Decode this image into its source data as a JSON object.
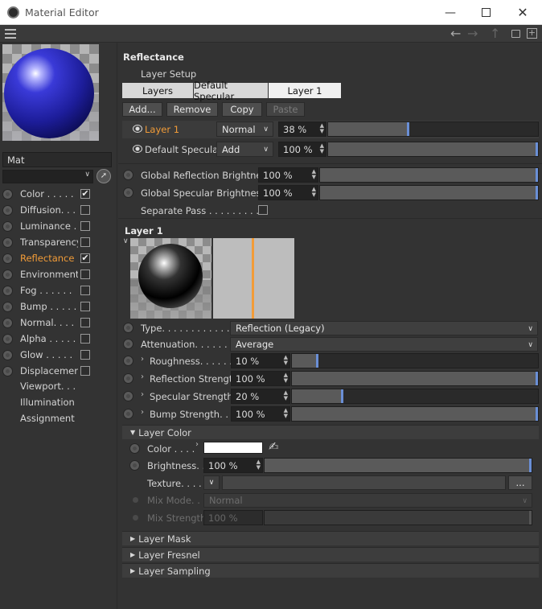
{
  "window": {
    "title": "Material Editor"
  },
  "material": {
    "name": "Mat"
  },
  "channels": [
    {
      "label": "Color . . . . .",
      "checked": true,
      "active": false
    },
    {
      "label": "Diffusion. . .",
      "checked": false,
      "active": false
    },
    {
      "label": "Luminance . .",
      "checked": false,
      "active": false
    },
    {
      "label": "Transparency",
      "checked": false,
      "active": false
    },
    {
      "label": "Reflectance .",
      "checked": true,
      "active": true
    },
    {
      "label": "Environment",
      "checked": false,
      "active": false
    },
    {
      "label": "Fog . . . . . .",
      "checked": false,
      "active": false
    },
    {
      "label": "Bump . . . . .",
      "checked": false,
      "active": false
    },
    {
      "label": "Normal. . . .",
      "checked": false,
      "active": false
    },
    {
      "label": "Alpha . . . . .",
      "checked": false,
      "active": false
    },
    {
      "label": "Glow . . . . .",
      "checked": false,
      "active": false
    },
    {
      "label": "Displacement",
      "checked": false,
      "active": false
    }
  ],
  "extras": [
    "Viewport. . .",
    "Illumination",
    "Assignment"
  ],
  "reflectance": {
    "title": "Reflectance",
    "layer_setup": "Layer Setup",
    "tabs": [
      "Layers",
      "Default Specular",
      "Layer 1"
    ],
    "buttons": {
      "add": "Add...",
      "remove": "Remove",
      "copy": "Copy",
      "paste": "Paste"
    },
    "layers": [
      {
        "name": "Layer 1",
        "mode": "Normal",
        "value": "38 %",
        "fraction": 0.38,
        "highlight": true
      },
      {
        "name": "Default Specular",
        "mode": "Add",
        "value": "100 %",
        "fraction": 1.0,
        "highlight": false
      }
    ],
    "global_reflection": {
      "label": "Global Reflection Brightness",
      "value": "100 %",
      "fraction": 1.0
    },
    "global_specular": {
      "label": "Global Specular Brightness",
      "value": "100 %",
      "fraction": 1.0
    },
    "separate_pass": {
      "label": "Separate Pass . . . . . . . . . .",
      "checked": false
    }
  },
  "layer1": {
    "title": "Layer 1",
    "type": {
      "label": "Type. . . . . . . . . . . .",
      "value": "Reflection (Legacy)"
    },
    "attenuation": {
      "label": "Attenuation. . . . . . .",
      "value": "Average"
    },
    "roughness": {
      "label": "Roughness. . . . . .",
      "value": "10 %",
      "fraction": 0.1
    },
    "reflection_strength": {
      "label": "Reflection Strength",
      "value": "100 %",
      "fraction": 1.0
    },
    "specular_strength": {
      "label": "Specular Strength",
      "value": "20 %",
      "fraction": 0.2
    },
    "bump_strength": {
      "label": "Bump Strength. . .",
      "value": "100 %",
      "fraction": 1.0
    }
  },
  "layer_color": {
    "title": "Layer Color",
    "color_label": "Color . . . .",
    "color_value": "#ffffff",
    "brightness_label": "Brightness. .",
    "brightness_value": "100 %",
    "brightness_fraction": 1.0,
    "texture_label": "Texture. . . .",
    "texture_button": "...",
    "mix_mode_label": "Mix Mode. .",
    "mix_mode_value": "Normal",
    "mix_strength_label": "Mix Strength",
    "mix_strength_value": "100 %"
  },
  "sections": [
    "Layer Mask",
    "Layer Fresnel",
    "Layer Sampling"
  ],
  "colors": {
    "accent": "#f29c38",
    "slider_mark": "#6a8fd6",
    "panel": "#333333"
  }
}
